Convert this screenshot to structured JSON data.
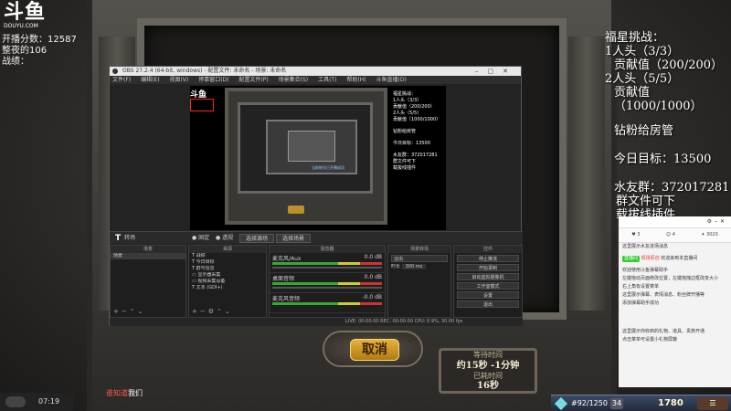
{
  "overlay_left": {
    "logo_text": "斗鱼",
    "logo_sub": "DOUYU.COM",
    "lines": [
      "开播分数：12587",
      "整夜的106",
      "战绩："
    ]
  },
  "overlay_right": {
    "title": "福星挑战：",
    "line1": "1人头（3/3）",
    "line2": "贡献值（200/200）",
    "line3": "2人头（5/5）",
    "line4": "贡献值（1000/1000）",
    "line5": "钻粉给房管",
    "line6": "今日目标：13500",
    "line7": "水友群：372017281",
    "line8": "群文件可下",
    "line9": "载拔线插件"
  },
  "obs": {
    "title": "OBS 27.2.4 (64-bit, windows) - 配置文件: 未命名 - 场景: 未命名",
    "menu": [
      "文件(F)",
      "编辑(E)",
      "视图(V)",
      "停靠窗口(D)",
      "配置文件(P)",
      "场景集合(S)",
      "工具(T)",
      "帮助(H)",
      "斗鱼直播(D)"
    ],
    "mode_label": "转场",
    "mode_radio1": "● 固定",
    "mode_radio2": "● 透视",
    "mode_btn1": "选择源场",
    "mode_btn2": "选择场景",
    "docks": {
      "scenes": {
        "header": "场景",
        "items": [
          "场景"
        ]
      },
      "sources": {
        "header": "来源",
        "items": [
          "战绩",
          "今日目标",
          "群号信息",
          "显示器采集",
          "视频采集设备",
          "文本 (GDI+)"
        ]
      },
      "mixer": {
        "header": "混音器",
        "channels": [
          {
            "name": "麦克风/Aux",
            "value": "0.0 dB"
          },
          {
            "name": "桌面音频",
            "value": "0.0 dB"
          },
          {
            "name": "麦克风音频",
            "value": "-0.0 dB"
          }
        ]
      },
      "transitions": {
        "header": "场景转场",
        "type": "淡出",
        "duration_label": "时长",
        "duration": "300 ms"
      },
      "controls": {
        "header": "控件",
        "buttons": [
          "停止推流",
          "开始录制",
          "启动虚拟摄像机",
          "工作室模式",
          "设置",
          "退出"
        ]
      }
    },
    "status": "LIVE: 00:00:00   REC: 00:00:00   CPU: 0.9%, 30.00 fps"
  },
  "preview": {
    "logo": "斗鱼",
    "text": [
      "福星挑战：",
      "1人头（3/3）",
      "贡献值（200/200）",
      "2人头（5/5）",
      "贡献值（1000/1000）",
      "钻粉给房管",
      "今日目标：13500",
      "水友群：372017281",
      "群文件可下",
      "载拔线插件"
    ],
    "popup": "当前账号已开播成功"
  },
  "game": {
    "cancel_label": "取消",
    "wait_label": "等待时间",
    "wait_estimate": "约15秒 -1分钟",
    "elapsed_label": "已耗时间",
    "elapsed": "16秒"
  },
  "chat": {
    "stats": [
      "3",
      "4",
      "3020"
    ],
    "messages": [
      {
        "text": "这里展示水友进场消息"
      },
      {
        "badge": "直播间",
        "name": "现场原创",
        "text": "欢迎来到本直播间"
      },
      {
        "text": "欢迎使用斗鱼弹幕助手"
      },
      {
        "text": "左键拖动页面修改位置，左键拖拽边框改变大小"
      },
      {
        "text": "右上角有设置菜单"
      },
      {
        "text": "这里展示弹幕、表情消息、粉丝牌开播等"
      },
      {
        "text": "添加弹幕助手成功"
      },
      {
        "text": "这里展示你收到的礼物、道具、贵族开通"
      },
      {
        "text": "点击菜单可设置小礼物屏蔽"
      }
    ]
  },
  "bottom": {
    "time": "07:19",
    "knows_name": "谁知道",
    "knows_rest": "我们",
    "rank": "#92/1250",
    "level": "34",
    "gold": "1780"
  },
  "colors": {
    "accent_gold": "#e7b23a",
    "obs_bg": "#232323",
    "chat_green": "#33cc33"
  }
}
